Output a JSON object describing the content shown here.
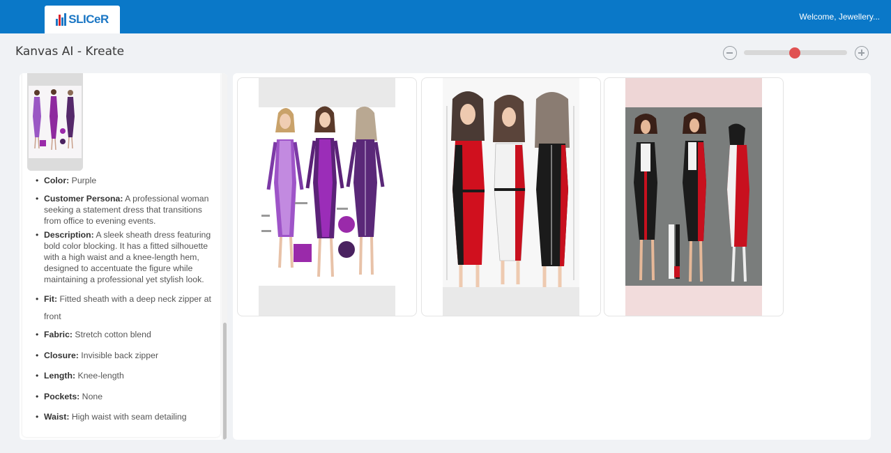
{
  "header": {
    "logo_text": "SLICeR",
    "welcome_text": "Welcome, Jewellery..."
  },
  "page": {
    "title": "Kanvas AI - Kreate"
  },
  "zoom": {
    "level": 0.5
  },
  "details": {
    "attributes": [
      {
        "label": "Color:",
        "value": " Purple"
      },
      {
        "label": "Customer Persona:",
        "value": " A professional woman seeking a statement dress that transitions from office to evening events."
      },
      {
        "label": "Description:",
        "value": " A sleek sheath dress featuring bold color blocking. It has a fitted silhouette with a high waist and a knee-length hem, designed to accentuate the figure while maintaining a professional yet stylish look."
      },
      {
        "label": "Fit:",
        "value": " Fitted sheath with a deep neck zipper at front"
      },
      {
        "label": "Fabric:",
        "value": " Stretch cotton blend"
      },
      {
        "label": "Closure:",
        "value": " Invisible back zipper"
      },
      {
        "label": "Length:",
        "value": " Knee-length"
      },
      {
        "label": "Pockets:",
        "value": " None"
      },
      {
        "label": "Waist:",
        "value": " High waist with seam detailing"
      }
    ]
  },
  "colors": {
    "header_bg": "#0a78c8",
    "accent_red": "#e05252",
    "purple": "#7b3fa0",
    "red": "#c8101e"
  },
  "gallery": {
    "images": [
      {
        "name": "purple-sketch"
      },
      {
        "name": "red-white-black-sketch"
      },
      {
        "name": "color-block-illustration"
      }
    ]
  }
}
